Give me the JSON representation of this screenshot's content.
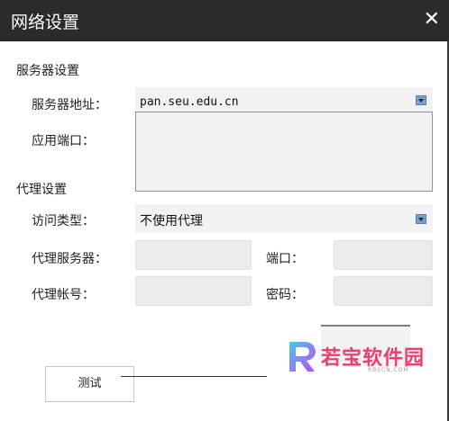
{
  "window": {
    "title": "网络设置",
    "close_glyph": "✕"
  },
  "server_section": {
    "heading": "服务器设置",
    "address_label": "服务器地址：",
    "address_value": "pan.seu.edu.cn",
    "port_label": "应用端口："
  },
  "proxy_section": {
    "heading": "代理设置",
    "access_type_label": "访问类型：",
    "access_type_value": "不使用代理",
    "server_label": "代理服务器：",
    "port_label": "端口：",
    "account_label": "代理帐号：",
    "password_label": "密码："
  },
  "buttons": {
    "test_label": "测试"
  },
  "watermark": {
    "text": "若宝软件园",
    "sub": "RBSCN.COM"
  },
  "colors": {
    "titlebar": "#2b2b2b",
    "field": "#ebebeb",
    "watermark": "#e8406f"
  }
}
